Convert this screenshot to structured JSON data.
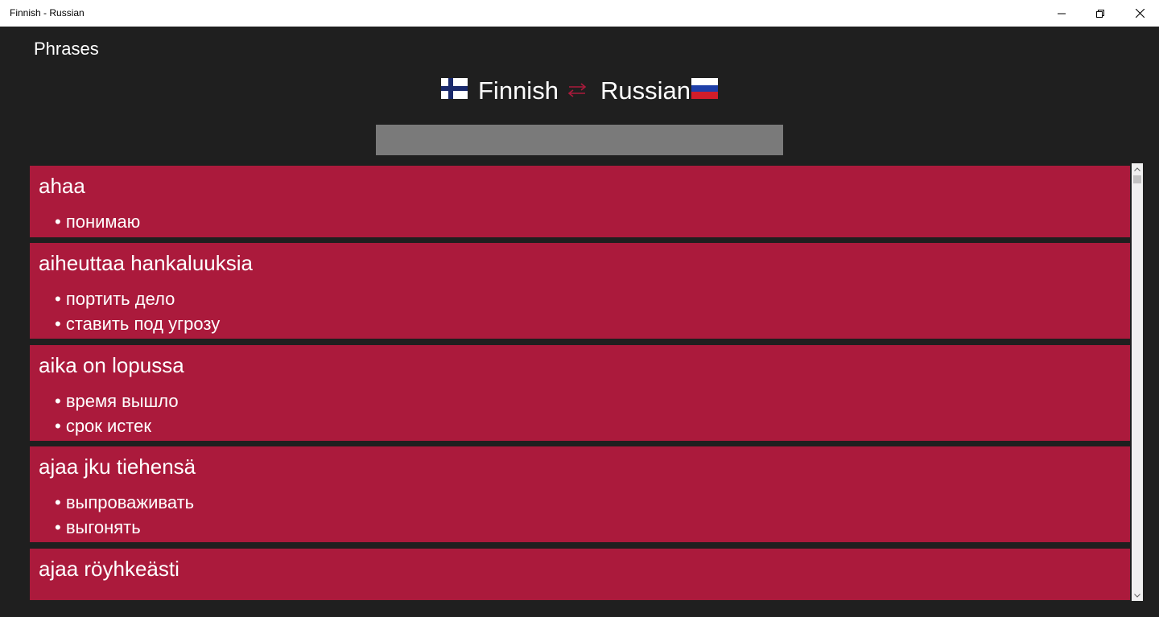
{
  "window": {
    "title": "Finnish - Russian"
  },
  "page": {
    "title": "Phrases"
  },
  "languages": {
    "source": "Finnish",
    "target": "Russian"
  },
  "search": {
    "value": "",
    "placeholder": ""
  },
  "colors": {
    "card_background": "#ab1a3c",
    "app_background": "#1f1f1f",
    "search_background": "#7a7a7a",
    "swap_icon": "#ab1a3c"
  },
  "icons": {
    "source_flag": "finland-flag-icon",
    "target_flag": "russia-flag-icon",
    "swap": "swap-arrows-icon"
  },
  "phrases": [
    {
      "phrase": "ahaa",
      "translations": [
        "• понимаю"
      ]
    },
    {
      "phrase": "aiheuttaa hankaluuksia",
      "translations": [
        "• портить дело",
        "•  ставить под угрозу"
      ]
    },
    {
      "phrase": "aika on lopussa",
      "translations": [
        "• время вышло",
        "•  срок истек"
      ]
    },
    {
      "phrase": "ajaa jku tiehensä",
      "translations": [
        "• выпроваживать",
        "•  выгонять"
      ]
    },
    {
      "phrase": "ajaa röyhkeästi",
      "translations": []
    }
  ]
}
